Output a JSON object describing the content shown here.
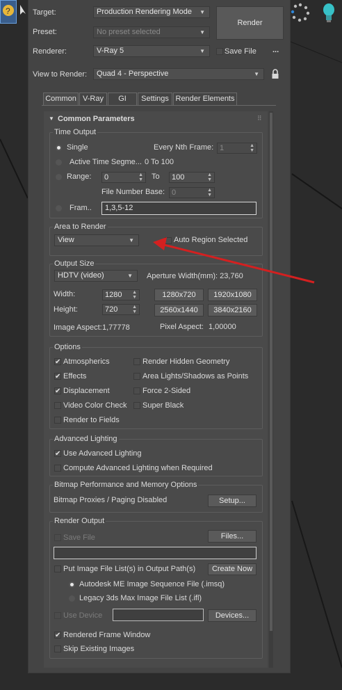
{
  "header": {
    "target_label": "Target:",
    "target_value": "Production Rendering Mode",
    "preset_label": "Preset:",
    "preset_value": "No preset selected",
    "renderer_label": "Renderer:",
    "renderer_value": "V-Ray 5",
    "save_file_label": "Save File",
    "more_label": "...",
    "view_label": "View to Render:",
    "view_value": "Quad 4 - Perspective",
    "render_button": "Render"
  },
  "tabs": [
    "Common",
    "V-Ray",
    "GI",
    "Settings",
    "Render Elements"
  ],
  "rollout": {
    "title": "Common Parameters"
  },
  "time_output": {
    "title": "Time Output",
    "single": "Single",
    "every_nth_label": "Every Nth Frame:",
    "every_nth_value": "1",
    "active_segment": "Active Time Segme...",
    "active_range": "0 To 100",
    "range": "Range:",
    "range_start": "0",
    "to": "To",
    "range_end": "100",
    "file_number_base_label": "File Number Base:",
    "file_number_base_value": "0",
    "frames": "Fram..",
    "frames_value": "1,3,5-12"
  },
  "area_to_render": {
    "title": "Area to Render",
    "value": "View",
    "auto_region": "Auto Region Selected"
  },
  "output_size": {
    "title": "Output Size",
    "preset": "HDTV (video)",
    "aperture": "Aperture Width(mm): 23,760",
    "width_label": "Width:",
    "width_value": "1280",
    "height_label": "Height:",
    "height_value": "720",
    "presets": [
      "1280x720",
      "1920x1080",
      "2560x1440",
      "3840x2160"
    ],
    "image_aspect": "Image Aspect:",
    "image_aspect_value": "1,77778",
    "pixel_aspect": "Pixel Aspect:",
    "pixel_aspect_value": "1,00000"
  },
  "options": {
    "title": "Options",
    "items": [
      {
        "label": "Atmospherics",
        "checked": true
      },
      {
        "label": "Render Hidden Geometry",
        "checked": false
      },
      {
        "label": "Effects",
        "checked": true
      },
      {
        "label": "Area Lights/Shadows as Points",
        "checked": false
      },
      {
        "label": "Displacement",
        "checked": true
      },
      {
        "label": "Force 2-Sided",
        "checked": false
      },
      {
        "label": "Video Color Check",
        "checked": false
      },
      {
        "label": "Super Black",
        "checked": false
      },
      {
        "label": "Render to Fields",
        "checked": false
      }
    ]
  },
  "advanced_lighting": {
    "title": "Advanced Lighting",
    "use": "Use Advanced Lighting",
    "compute": "Compute Advanced Lighting when Required"
  },
  "bitmap": {
    "title": "Bitmap Performance and Memory Options",
    "status": "Bitmap Proxies / Paging Disabled",
    "setup": "Setup..."
  },
  "render_output": {
    "title": "Render Output",
    "save_file": "Save File",
    "files": "Files...",
    "put_image": "Put Image File List(s) in Output Path(s)",
    "create_now": "Create Now",
    "imsq": "Autodesk ME Image Sequence File (.imsq)",
    "ifl": "Legacy 3ds Max Image File List (.ifl)",
    "use_device": "Use Device",
    "devices": "Devices...",
    "rendered_frame_window": "Rendered Frame Window",
    "skip_existing": "Skip Existing Images"
  },
  "colors": {
    "background": "#2b2b2b",
    "panel": "#444444",
    "arrow": "#d42020",
    "accent": "#2f6fb3"
  }
}
